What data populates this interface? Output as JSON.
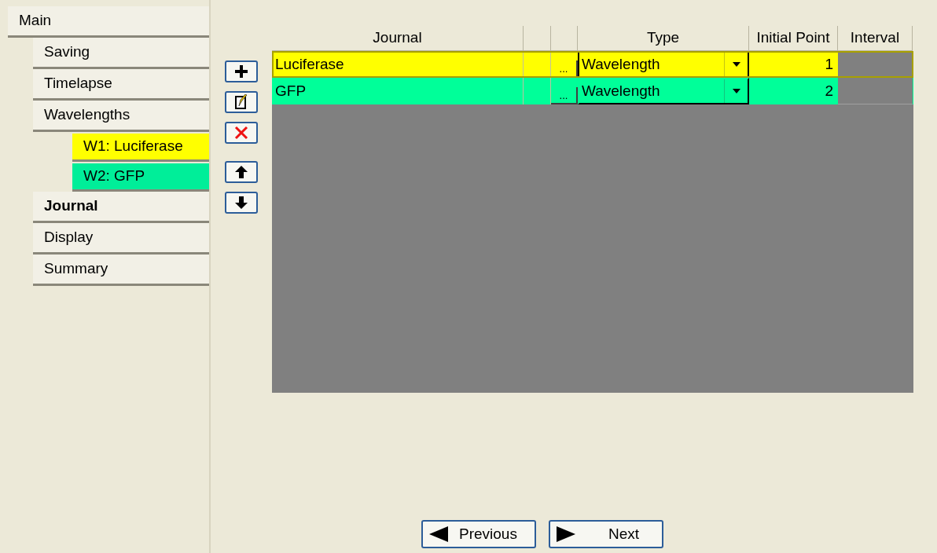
{
  "nav": [
    {
      "label": "Main",
      "selected": false,
      "children": [
        {
          "label": "Saving",
          "selected": false
        },
        {
          "label": "Timelapse",
          "selected": false
        },
        {
          "label": "Wavelengths",
          "selected": false,
          "children": [
            {
              "label": "W1: Luciferase",
              "selected": false,
              "color": "#ffff00"
            },
            {
              "label": "W2: GFP",
              "selected": false,
              "color": "#00ee99"
            }
          ]
        },
        {
          "label": "Journal",
          "selected": true
        },
        {
          "label": "Display",
          "selected": false
        },
        {
          "label": "Summary",
          "selected": false
        }
      ]
    }
  ],
  "toolbar": [
    {
      "kind": "add"
    },
    {
      "kind": "edit"
    },
    {
      "kind": "delete"
    },
    {
      "kind": "up"
    },
    {
      "kind": "down"
    }
  ],
  "table": {
    "columns": [
      "Journal",
      "",
      "",
      "Type",
      "Initial Point",
      "Interval"
    ],
    "rows": [
      {
        "journal": "Luciferase",
        "browse": "...",
        "type": "Wavelength",
        "initial_point": "1",
        "color": "#ffff00",
        "selected": true
      },
      {
        "journal": "GFP",
        "browse": "...",
        "type": "Wavelength",
        "initial_point": "2",
        "color": "#00ff99",
        "selected": false
      }
    ]
  },
  "buttons": [
    {
      "kind": "previous",
      "label": "Previous"
    },
    {
      "kind": "next",
      "label": "Next"
    }
  ]
}
